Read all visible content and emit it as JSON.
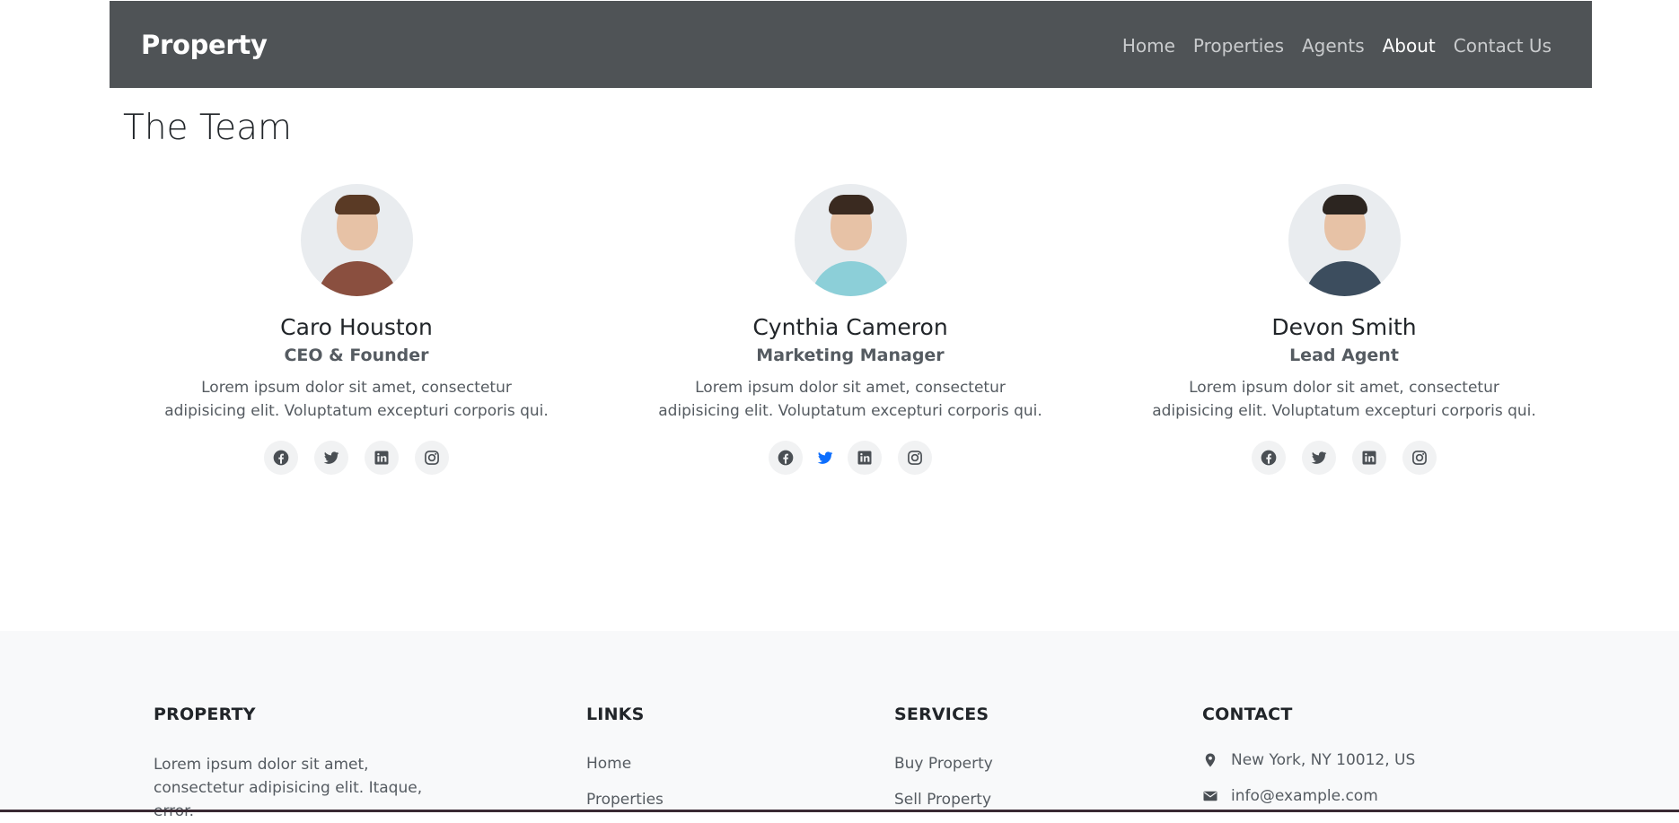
{
  "navbar": {
    "brand": "Property",
    "links": [
      {
        "label": "Home"
      },
      {
        "label": "Properties"
      },
      {
        "label": "Agents"
      },
      {
        "label": "About",
        "active": true
      },
      {
        "label": "Contact Us"
      }
    ]
  },
  "section": {
    "title": "The Team"
  },
  "team": [
    {
      "name": "Caro Houston",
      "role": "CEO & Founder",
      "description": "Lorem ipsum dolor sit amet, consectetur adipisicing elit. Voluptatum excepturi corporis qui."
    },
    {
      "name": "Cynthia Cameron",
      "role": "Marketing Manager",
      "description": "Lorem ipsum dolor sit amet, consectetur adipisicing elit. Voluptatum excepturi corporis qui."
    },
    {
      "name": "Devon Smith",
      "role": "Lead Agent",
      "description": "Lorem ipsum dolor sit amet, consectetur adipisicing elit. Voluptatum excepturi corporis qui."
    }
  ],
  "social_icons": [
    "facebook-icon",
    "twitter-icon",
    "linkedin-icon",
    "instagram-icon"
  ],
  "footer": {
    "property": {
      "heading": "PROPERTY",
      "text": "Lorem ipsum dolor sit amet, consectetur adipisicing elit. Itaque, error."
    },
    "links": {
      "heading": "LINKS",
      "items": [
        "Home",
        "Properties"
      ]
    },
    "services": {
      "heading": "SERVICES",
      "items": [
        "Buy Property",
        "Sell Property"
      ]
    },
    "contact": {
      "heading": "CONTACT",
      "address": "New York, NY 10012, US",
      "email": "info@example.com"
    }
  },
  "colors": {
    "navbar_bg": "#4f5356",
    "footer_bg": "#f8f9fa",
    "twitter_active": "#0d6efd",
    "icon_color": "#4a4f54"
  }
}
